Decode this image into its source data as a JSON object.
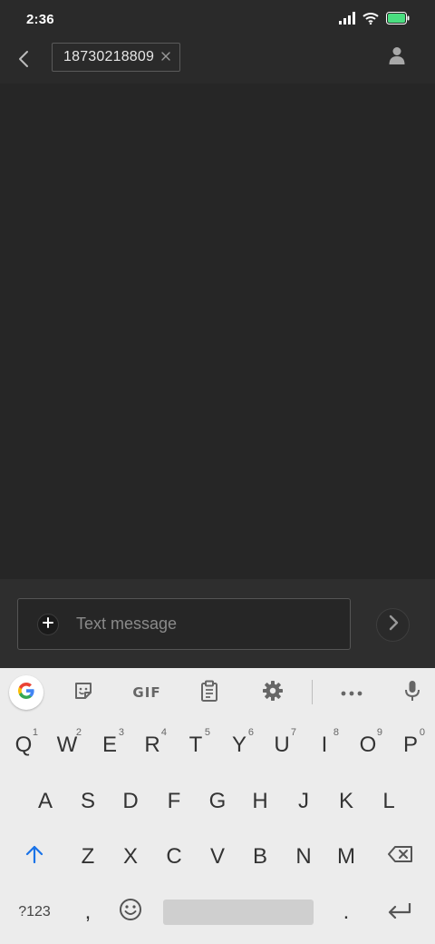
{
  "status_bar": {
    "time": "2:36",
    "icons": [
      "signal-icon",
      "wifi-icon",
      "battery-icon"
    ],
    "battery_color": "#4ade80"
  },
  "header": {
    "back_icon": "chevron-left-icon",
    "recipient": "18730218809",
    "remove_icon": "close-icon",
    "contact_icon": "person-icon"
  },
  "composer": {
    "attach_icon": "plus-icon",
    "placeholder": "Text message",
    "value": "",
    "send_icon": "chevron-right-icon"
  },
  "keyboard": {
    "toolbar": {
      "items": [
        "google-icon",
        "sticker-icon",
        "GIF",
        "clipboard-icon",
        "gear-icon",
        "more-icon",
        "mic-icon"
      ],
      "gif_label": "GIF"
    },
    "row1": [
      {
        "label": "Q",
        "hint": "1"
      },
      {
        "label": "W",
        "hint": "2"
      },
      {
        "label": "E",
        "hint": "3"
      },
      {
        "label": "R",
        "hint": "4"
      },
      {
        "label": "T",
        "hint": "5"
      },
      {
        "label": "Y",
        "hint": "6"
      },
      {
        "label": "U",
        "hint": "7"
      },
      {
        "label": "I",
        "hint": "8"
      },
      {
        "label": "O",
        "hint": "9"
      },
      {
        "label": "P",
        "hint": "0"
      }
    ],
    "row2": [
      "A",
      "S",
      "D",
      "F",
      "G",
      "H",
      "J",
      "K",
      "L"
    ],
    "row3": [
      "Z",
      "X",
      "C",
      "V",
      "B",
      "N",
      "M"
    ],
    "row4": {
      "symbols": "?123",
      "comma": ",",
      "period": ".",
      "shift_icon": "shift-icon",
      "backspace_icon": "backspace-icon",
      "emoji_icon": "emoji-icon",
      "enter_icon": "enter-icon"
    },
    "accent_color": "#1a73e8"
  }
}
